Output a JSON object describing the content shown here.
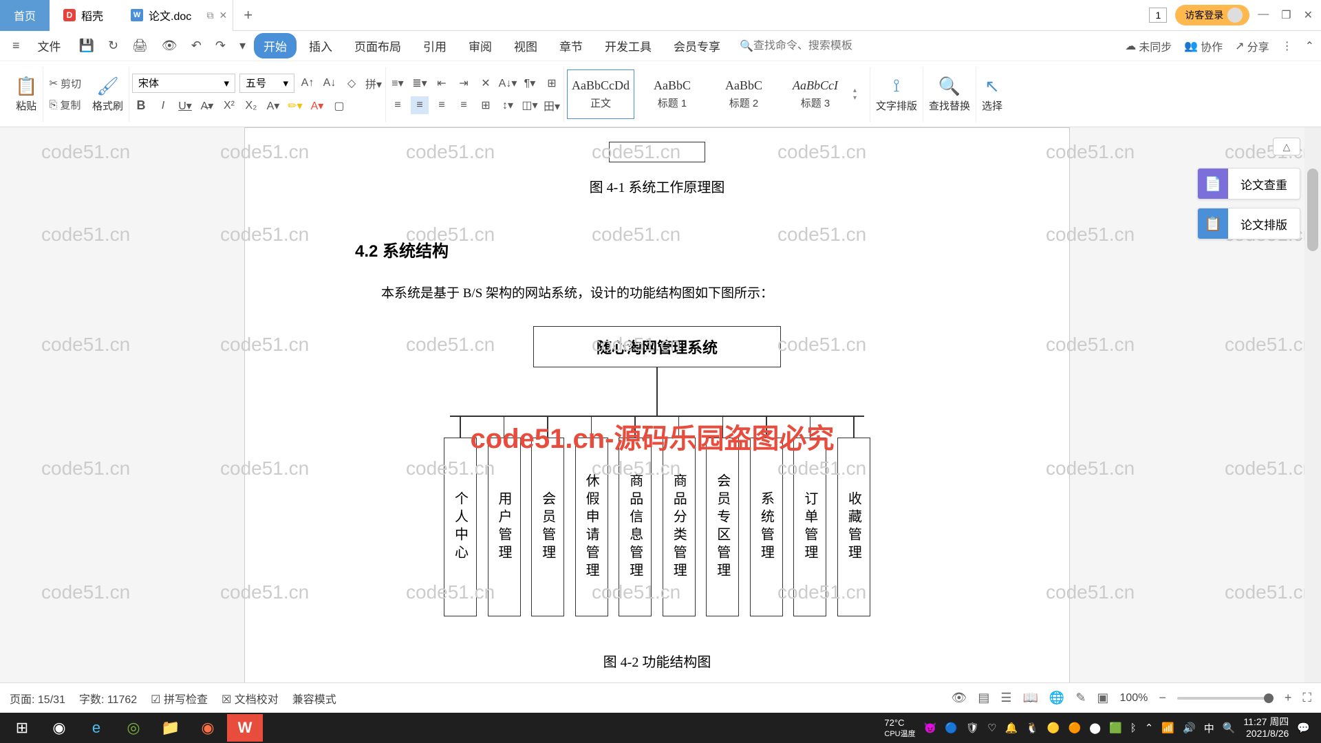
{
  "tabs": {
    "home": "首页",
    "doke": "稻壳",
    "doc": "论文.doc",
    "count": "1",
    "login": "访客登录"
  },
  "menu": {
    "file": "文件",
    "items": [
      "开始",
      "插入",
      "页面布局",
      "引用",
      "审阅",
      "视图",
      "章节",
      "开发工具",
      "会员专享"
    ],
    "search_placeholder": "查找命令、搜索模板",
    "unsync": "未同步",
    "coop": "协作",
    "share": "分享"
  },
  "ribbon": {
    "paste": "粘贴",
    "cut": "剪切",
    "copy": "复制",
    "format_brush": "格式刷",
    "font_name": "宋体",
    "font_size": "五号",
    "styles": [
      {
        "prev": "AaBbCcDd",
        "name": "正文"
      },
      {
        "prev": "AaBbC",
        "name": "标题 1"
      },
      {
        "prev": "AaBbC",
        "name": "标题 2"
      },
      {
        "prev": "AaBbCcI",
        "name": "标题 3"
      }
    ],
    "text_layout": "文字排版",
    "find_replace": "查找替换",
    "select": "选择"
  },
  "doc": {
    "caption1": "图 4-1 系统工作原理图",
    "section_title": "4.2 系统结构",
    "paragraph": "本系统是基于 B/S 架构的网站系统，设计的功能结构图如下图所示：",
    "org_root": "随心淘网管理系统",
    "org_items": [
      "个人中心",
      "用户管理",
      "会员管理",
      "休假申请管理",
      "商品信息管理",
      "商品分类管理",
      "会员专区管理",
      "系统管理",
      "订单管理",
      "收藏管理"
    ],
    "caption2": "图 4-2 功能结构图",
    "watermark": "code51.cn",
    "watermark_big": "code51.cn-源码乐园盗图必究"
  },
  "sidepanel": {
    "check": "论文查重",
    "layout": "论文排版"
  },
  "status": {
    "page": "页面: 15/31",
    "words": "字数: 11762",
    "spell": "拼写检查",
    "proof": "文档校对",
    "compat": "兼容模式",
    "zoom": "100%"
  },
  "taskbar": {
    "temp": "72°C",
    "cpu": "CPU温度",
    "time": "11:27",
    "weekday": "周四",
    "date": "2021/8/26"
  }
}
